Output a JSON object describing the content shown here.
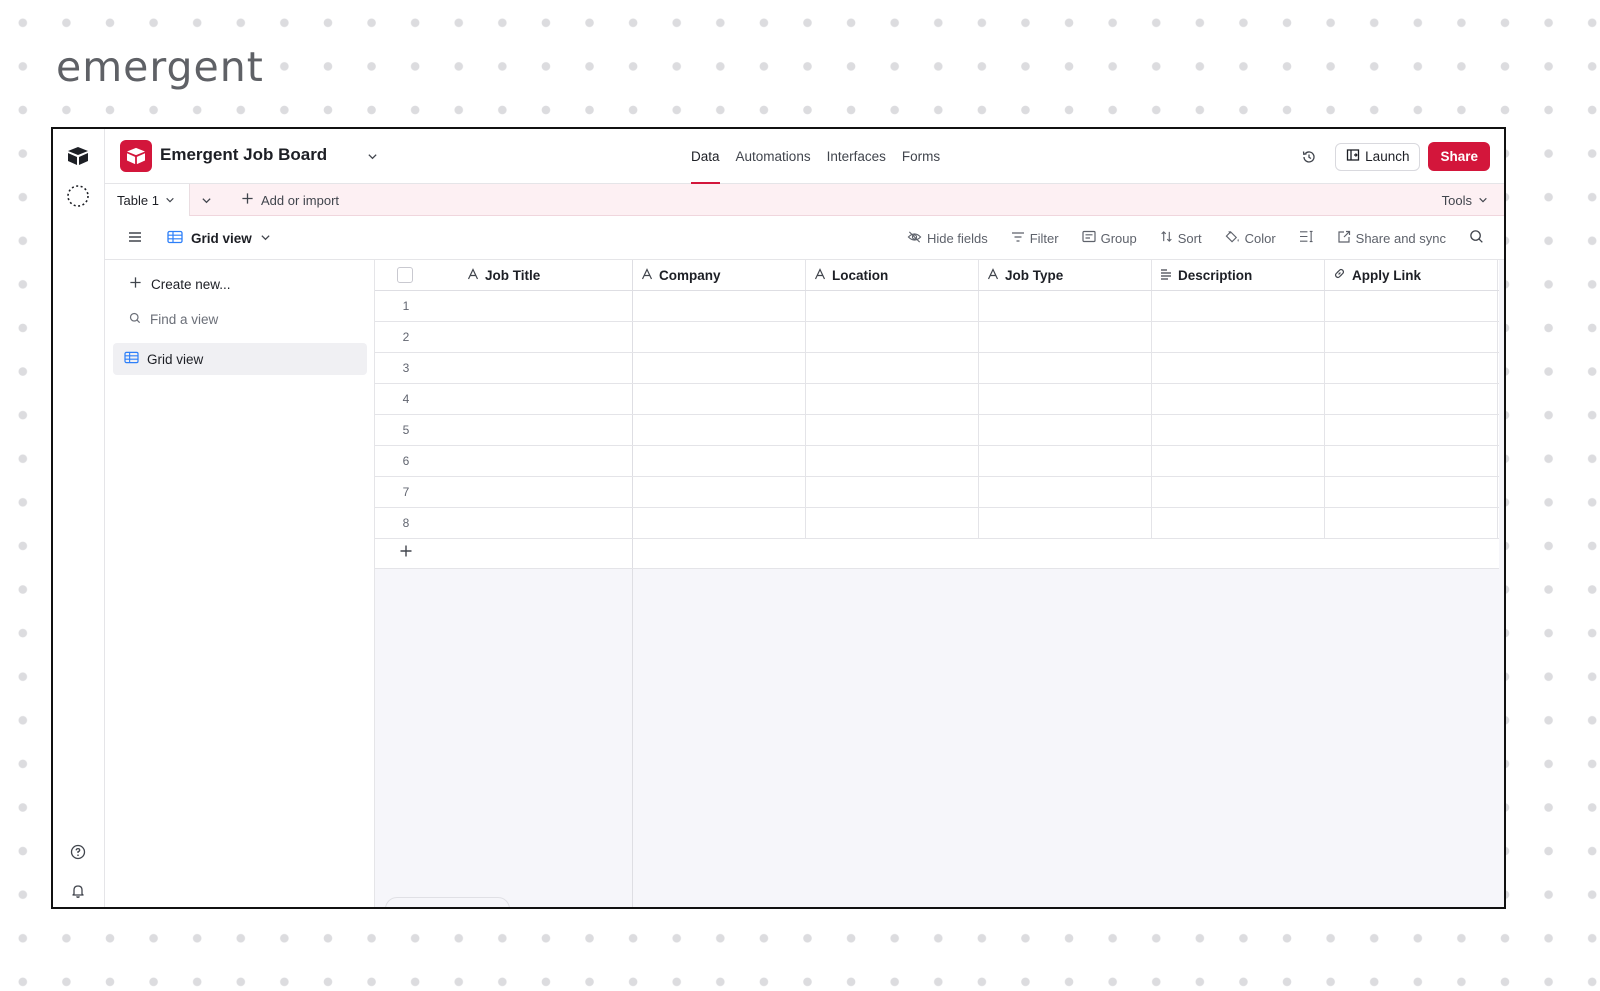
{
  "brand": {
    "logo_text": "emergent"
  },
  "header": {
    "base_name": "Emergent Job Board",
    "nav_tabs": [
      {
        "label": "Data",
        "active": true
      },
      {
        "label": "Automations",
        "active": false
      },
      {
        "label": "Interfaces",
        "active": false
      },
      {
        "label": "Forms",
        "active": false
      }
    ],
    "launch_label": "Launch",
    "share_label": "Share"
  },
  "tabbar": {
    "table_name": "Table 1",
    "add_import_label": "Add or import",
    "tools_label": "Tools"
  },
  "viewbar": {
    "view_name": "Grid view",
    "tools": [
      {
        "label": "Hide fields",
        "icon": "eye-slash-icon"
      },
      {
        "label": "Filter",
        "icon": "filter-icon"
      },
      {
        "label": "Group",
        "icon": "group-icon"
      },
      {
        "label": "Sort",
        "icon": "sort-icon"
      },
      {
        "label": "Color",
        "icon": "paint-bucket-icon"
      },
      {
        "label": "",
        "icon": "row-height-icon"
      },
      {
        "label": "Share and sync",
        "icon": "share-external-icon"
      }
    ]
  },
  "sidebar": {
    "create_label": "Create new...",
    "find_placeholder": "Find a view",
    "views": [
      {
        "label": "Grid view",
        "selected": true
      }
    ]
  },
  "grid": {
    "columns": [
      {
        "label": "Job Title",
        "icon": "text-field-icon"
      },
      {
        "label": "Company",
        "icon": "text-field-icon"
      },
      {
        "label": "Location",
        "icon": "text-field-icon"
      },
      {
        "label": "Job Type",
        "icon": "text-field-icon"
      },
      {
        "label": "Description",
        "icon": "long-text-icon"
      },
      {
        "label": "Apply Link",
        "icon": "link-icon"
      }
    ],
    "rows": [
      "1",
      "2",
      "3",
      "4",
      "5",
      "6",
      "7",
      "8"
    ]
  },
  "colors": {
    "accent": "#d3163b",
    "tabbar_bg": "#fdf0f3",
    "grid_bg": "#f6f6fa"
  }
}
